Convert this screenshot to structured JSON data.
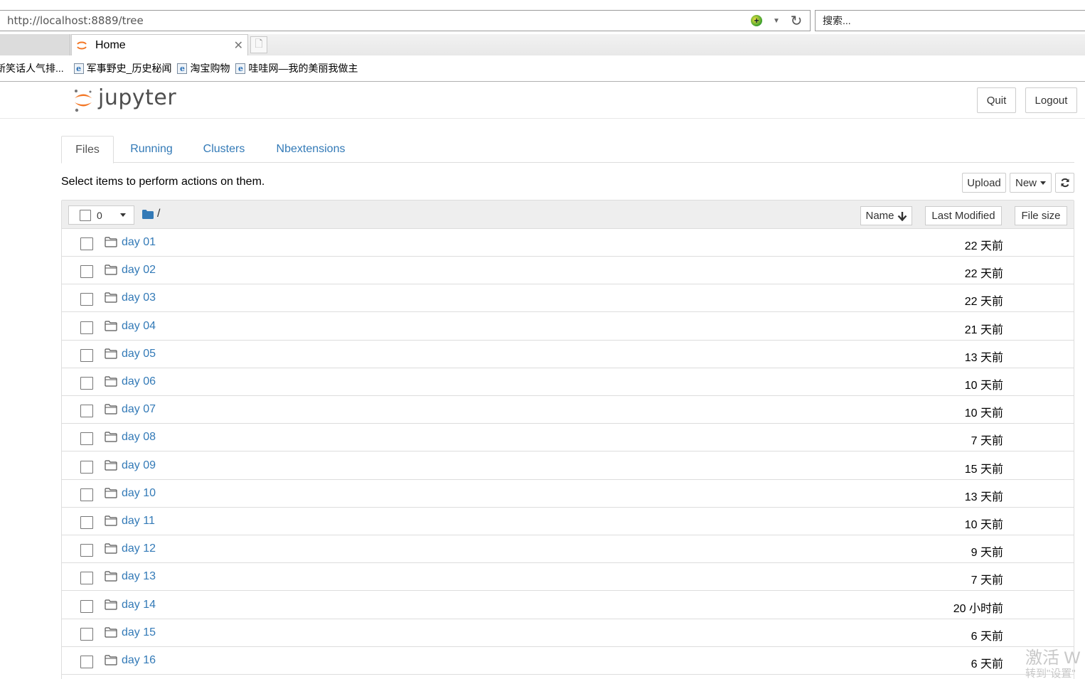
{
  "browser": {
    "url": "http://localhost:8889/tree",
    "search_placeholder": "搜索...",
    "tab_title": "Home",
    "favorites": [
      "新笑话人气排...",
      "军事野史_历史秘闻",
      "淘宝购物",
      "哇哇网—我的美丽我做主"
    ]
  },
  "header": {
    "logo_text": "jupyter",
    "quit_label": "Quit",
    "logout_label": "Logout"
  },
  "tabs": [
    {
      "label": "Files"
    },
    {
      "label": "Running"
    },
    {
      "label": "Clusters"
    },
    {
      "label": "Nbextensions"
    }
  ],
  "toolbar": {
    "instruction": "Select items to perform actions on them.",
    "upload_label": "Upload",
    "new_label": "New"
  },
  "list_header": {
    "selected_count": "0",
    "path": "/",
    "sort_name": "Name",
    "sort_modified": "Last Modified",
    "sort_size": "File size"
  },
  "files": [
    {
      "name": "day 01",
      "modified": "22 天前"
    },
    {
      "name": "day 02",
      "modified": "22 天前"
    },
    {
      "name": "day 03",
      "modified": "22 天前"
    },
    {
      "name": "day 04",
      "modified": "21 天前"
    },
    {
      "name": "day 05",
      "modified": "13 天前"
    },
    {
      "name": "day 06",
      "modified": "10 天前"
    },
    {
      "name": "day 07",
      "modified": "10 天前"
    },
    {
      "name": "day 08",
      "modified": "7 天前"
    },
    {
      "name": "day 09",
      "modified": "15 天前"
    },
    {
      "name": "day 10",
      "modified": "13 天前"
    },
    {
      "name": "day 11",
      "modified": "10 天前"
    },
    {
      "name": "day 12",
      "modified": "9 天前"
    },
    {
      "name": "day 13",
      "modified": "7 天前"
    },
    {
      "name": "day 14",
      "modified": "20 小时前"
    },
    {
      "name": "day 15",
      "modified": "6 天前"
    },
    {
      "name": "day 16",
      "modified": "6 天前"
    }
  ],
  "watermark": {
    "line1": "激活 W",
    "line2": "转到\"设置\""
  },
  "colors": {
    "link": "#337ab7",
    "jupyter_orange": "#f37726"
  }
}
